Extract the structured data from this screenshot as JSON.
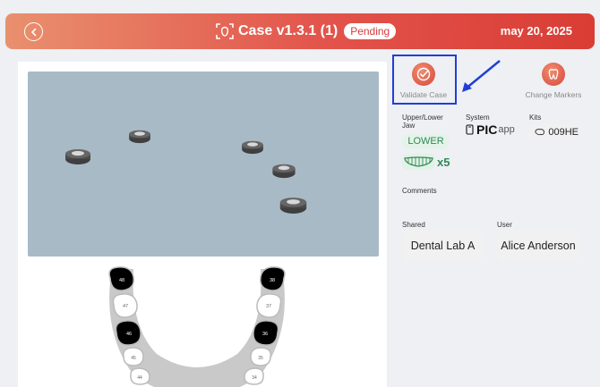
{
  "header": {
    "title": "Case v1.3.1 (1)",
    "status": "Pending",
    "date": "may 20, 2025"
  },
  "actions": {
    "validate_label": "Validate Case",
    "markers_label": "Change Markers"
  },
  "details": {
    "jaw_label": "Upper/Lower Jaw",
    "jaw_value": "LOWER",
    "teeth_count": "x5",
    "system_label": "System",
    "system_brand": "PIC",
    "system_brand_suffix": "app",
    "kits_label": "Kits",
    "kit_value": "009HE",
    "comments_label": "Comments",
    "shared_label": "Shared",
    "shared_value": "Dental Lab A",
    "user_label": "User",
    "user_value": "Alice Anderson"
  },
  "jaw_chart": {
    "right_teeth": [
      "48",
      "47",
      "46",
      "45",
      "44"
    ],
    "left_teeth": [
      "38",
      "37",
      "36",
      "35",
      "34"
    ],
    "selected": [
      "48",
      "46",
      "38",
      "36"
    ]
  },
  "colors": {
    "accent": "#e2534b",
    "highlight": "#1f3fd6",
    "success": "#2e8a56",
    "viewer_bg": "#a8bac6"
  }
}
